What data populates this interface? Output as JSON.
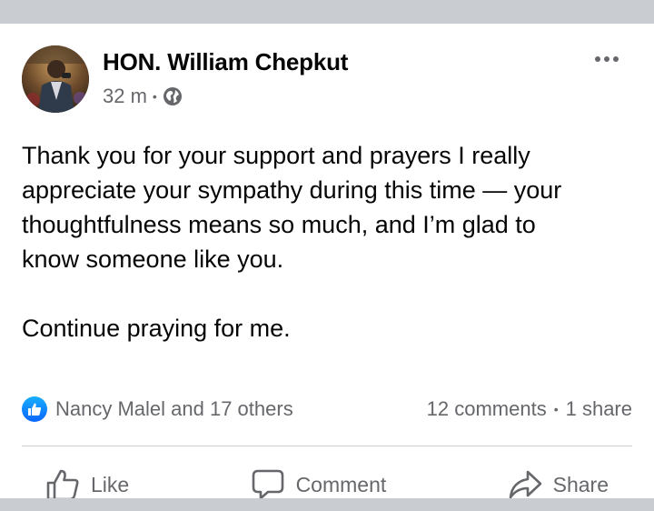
{
  "post": {
    "author": "HON. William Chepkut",
    "time": "32 m",
    "separator": "•",
    "privacy_icon": "globe-icon",
    "paragraphs": [
      "Thank you for your support and prayers  I really\nappreciate your sympathy during this time — your\nthoughtfulness means so much, and I’m glad to\nknow someone like you.",
      "Continue praying for me."
    ]
  },
  "engagement": {
    "reaction_icon": "thumbs-up-icon",
    "reactors": "Nancy Malel and 17 others",
    "comments": "12 comments",
    "separator": "•",
    "shares": "1 share"
  },
  "actions": {
    "like": "Like",
    "comment": "Comment",
    "share": "Share"
  },
  "colors": {
    "background": "#c9ccd1",
    "card": "#ffffff",
    "text_primary": "#050505",
    "text_secondary": "#65676b",
    "like_blue": "#0866ff",
    "divider": "#ced0d4"
  }
}
